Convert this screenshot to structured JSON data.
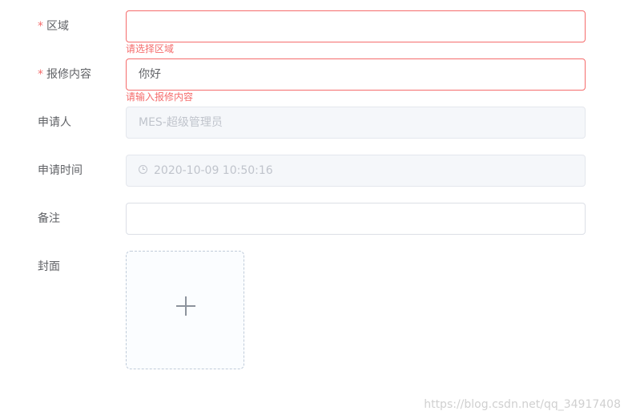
{
  "form": {
    "area": {
      "required_mark": "*",
      "label": "区域",
      "value": "",
      "error": "请选择区域"
    },
    "repair_content": {
      "required_mark": "*",
      "label": "报修内容",
      "value": "你好",
      "error": "请输入报修内容"
    },
    "applicant": {
      "label": "申请人",
      "value": "MES-超级管理员"
    },
    "apply_time": {
      "label": "申请时间",
      "value": "2020-10-09 10:50:16",
      "icon": "clock-icon"
    },
    "remark": {
      "label": "备注",
      "value": ""
    },
    "cover": {
      "label": "封面",
      "icon": "plus-icon"
    }
  },
  "watermark": "https://blog.csdn.net/qq_34917408",
  "colors": {
    "error": "#f56c6c",
    "label": "#606266",
    "disabled_bg": "#f5f7fa",
    "border": "#dcdfe6"
  }
}
